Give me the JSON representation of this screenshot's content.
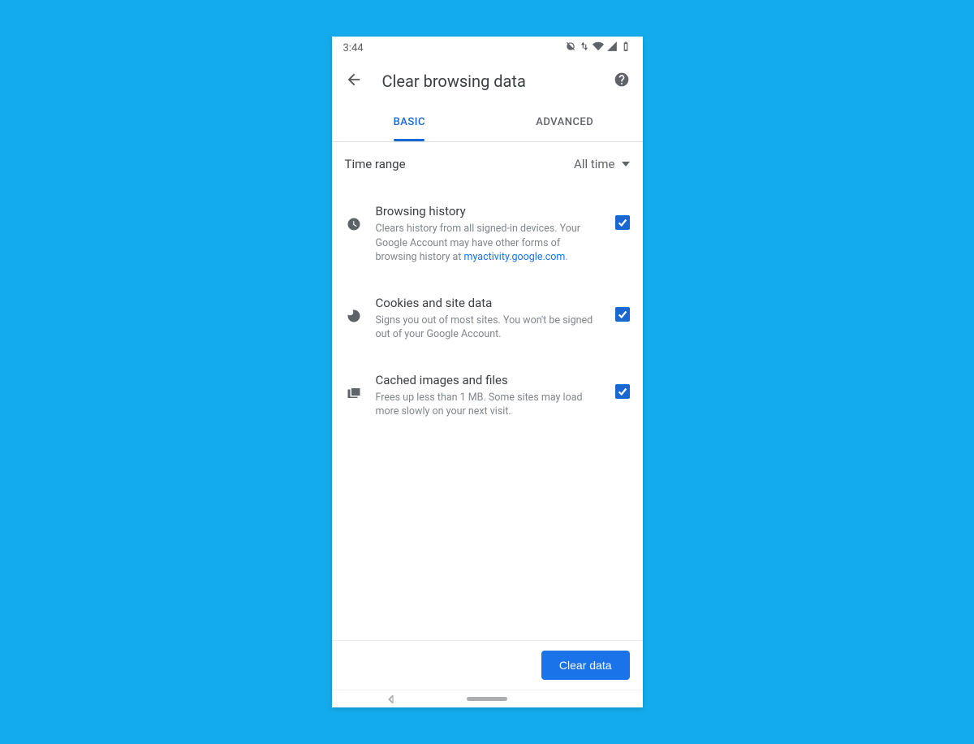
{
  "statusbar": {
    "time": "3:44"
  },
  "appbar": {
    "title": "Clear browsing data"
  },
  "tabs": {
    "basic": "BASIC",
    "advanced": "ADVANCED"
  },
  "timerange": {
    "label": "Time range",
    "value": "All time"
  },
  "items": {
    "history": {
      "title": "Browsing history",
      "desc_pre": "Clears history from all signed-in devices. Your Google Account may have other forms of browsing history at ",
      "link": "myactivity.google.com",
      "desc_post": "."
    },
    "cookies": {
      "title": "Cookies and site data",
      "desc": "Signs you out of most sites. You won't be signed out of your Google Account."
    },
    "cache": {
      "title": "Cached images and files",
      "desc": "Frees up less than 1 MB. Some sites may load more slowly on your next visit."
    }
  },
  "footer": {
    "clear": "Clear data"
  }
}
